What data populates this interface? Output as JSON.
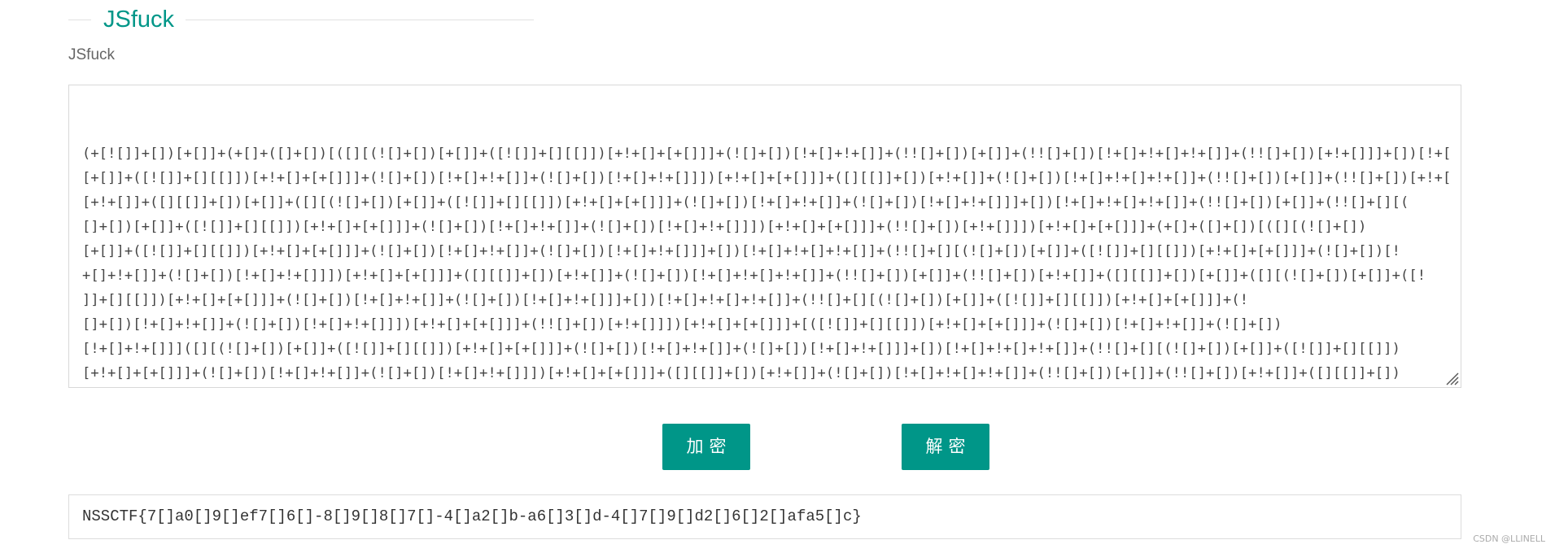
{
  "header": {
    "title": "JSfuck",
    "subtitle": "JSfuck"
  },
  "editor": {
    "lines": [
      "(+[![]]+[])[+[]]+(+[]+([]+[])[([][(![]+[])[+[]]+([![]]+[][[]])[+!+[]+[+[]]]+(![]+[])[!+[]+!+[]]+(!![]+[])[+[]]+(!![]+[])[!+[]+!+[]+!+[]]+(!![]+[])[+!+[]]]+[])[!+[]+!+[]+!+[]]+(!![]+[][(![]+[])",
      "[+[]]+([![]]+[][[]])[+!+[]+[+[]]]+(![]+[])[!+[]+!+[]]+(![]+[])[!+[]+!+[]]])[+!+[]+[+[]]]+([][[]]+[])[+!+[]]+(![]+[])[!+[]+!+[]+!+[]]+(!![]+[])[+[]]+(!![]+[])[+!+[]]+(!![]+[])",
      "[+!+[]]+([][[]]+[])[+[]]+([][(![]+[])[+[]]+([![]]+[][[]])[+!+[]+[+[]]]+(![]+[])[!+[]+!+[]]+(![]+[])[!+[]+!+[]]]+[])[!+[]+!+[]+!+[]]+(!![]+[])[+[]]+(!![]+[][(",
      "[]+[])[+[]]+([![]]+[][[]])[+!+[]+[+[]]]+(![]+[])[!+[]+!+[]]+(![]+[])[!+[]+!+[]]])[+!+[]+[+[]]]+(!![]+[])[+!+[]]])[+!+[]+[+[]]]+(+[]+([]+[])[([][(![]+[])",
      "[+[]]+([![]]+[][[]])[+!+[]+[+[]]]+(![]+[])[!+[]+!+[]]+(![]+[])[!+[]+!+[]]]+[])[!+[]+!+[]+!+[]]+(!![]+[][(![]+[])[+[]]+([![]]+[][[]])[+!+[]+[+[]]]+(![]+[])[!",
      "+[]+!+[]]+(![]+[])[!+[]+!+[]]])[+!+[]+[+[]]]+([][[]]+[])[+!+[]]+(![]+[])[!+[]+!+[]+!+[]]+(!![]+[])[+[]]+(!![]+[])[+!+[]]+([][[]]+[])[+[]]+([][(![]+[])[+[]]+([!",
      "]]+[][[]])[+!+[]+[+[]]]+(![]+[])[!+[]+!+[]]+(![]+[])[!+[]+!+[]]]+[])[!+[]+!+[]+!+[]]+(!![]+[][(![]+[])[+[]]+([![]]+[][[]])[+!+[]+[+[]]]+(!",
      "[]+[])[!+[]+!+[]]+(![]+[])[!+[]+!+[]]])[+!+[]+[+[]]]+(!![]+[])[+!+[]]])[+!+[]+[+[]]]+[([![]]+[][[]])[+!+[]+[+[]]]+(![]+[])[!+[]+!+[]]+(![]+[])",
      "[!+[]+!+[]]]([][(![]+[])[+[]]+([![]]+[][[]])[+!+[]+[+[]]]+(![]+[])[!+[]+!+[]]+(![]+[])[!+[]+!+[]]]+[])[!+[]+!+[]+!+[]]+(!![]+[][(![]+[])[+[]]+([![]]+[][[]])",
      "[+!+[]+[+[]]]+(![]+[])[!+[]+!+[]]+(![]+[])[!+[]+!+[]]])[+!+[]+[+[]]]+([][[]]+[])[+!+[]]+(![]+[])[!+[]+!+[]+!+[]]+(!![]+[])[+[]]+(!![]+[])[+!+[]]+([][[]]+[])",
      "[+[]]+([][(![]+[])[+[]]+([![]]+[][[]])[+!+[]+[+[]]]+(![]+[])[!+[]+!+[]]+(![]+[])[!+[]+!+[]]]+[])[!+[]+!+[]+!+[]]+(!![]+[])[+[]]+(!![]+[][(![]+[])[+[]]+([!",
      "[]]+[][[]])[+!+[]+[+[]]]+(![]+[])[!+[]+!+[]]+(![]+[])[!+[]+!+[]]])[+!+[]+[+[]]]+(!![]+[])[+!+[]]]((!![]+[])[+!+[]]+(!![]+[])[!+[]+!+[]+!+[]]+(!![]+[])[+[]]+([]"
    ]
  },
  "buttons": {
    "encrypt": "加密",
    "decrypt": "解密"
  },
  "result": {
    "value": "NSSCTF{7[]a0[]9[]ef7[]6[]-8[]9[]8[]7[]-4[]a2[]b-a6[]3[]d-4[]7[]9[]d2[]6[]2[]afa5[]c}"
  },
  "watermark": "CSDN @LLINELL",
  "colors": {
    "accent": "#009688",
    "border": "#d8d8d8",
    "text": "#444444"
  }
}
